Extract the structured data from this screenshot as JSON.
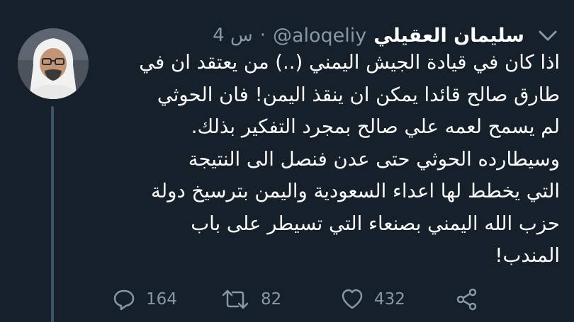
{
  "tweet": {
    "display_name": "سليمان العقيلي",
    "handle": "@aloqeliy",
    "separator": "·",
    "time": "4 س",
    "lines": [
      "اذا كان في قيادة الجيش اليمني (..) من يعتقد ان في",
      "طارق صالح قائدا يمكن ان ينقذ اليمن! فان الحوثي",
      "لم يسمح لعمه علي صالح بمجرد التفكير بذلك.",
      "وسيطارده الحوثي حتى عدن فنصل الى النتيجة",
      "التي يخطط لها اعداء السعودية واليمن بترسيخ دولة",
      "حزب الله اليمني بصنعاء التي تسيطر على باب",
      "المندب!"
    ]
  },
  "actions": {
    "replies": "164",
    "retweets": "82",
    "likes": "432"
  },
  "icons": {
    "reply": "speech-bubble-icon",
    "retweet": "retweet-arrows-icon",
    "like": "heart-outline-icon",
    "share": "share-nodes-icon",
    "menu": "chevron-down-icon"
  },
  "colors": {
    "background": "#15202b",
    "primary_text": "#ffffff",
    "secondary_text": "#8899a6",
    "thread_line": "#3d5466"
  }
}
